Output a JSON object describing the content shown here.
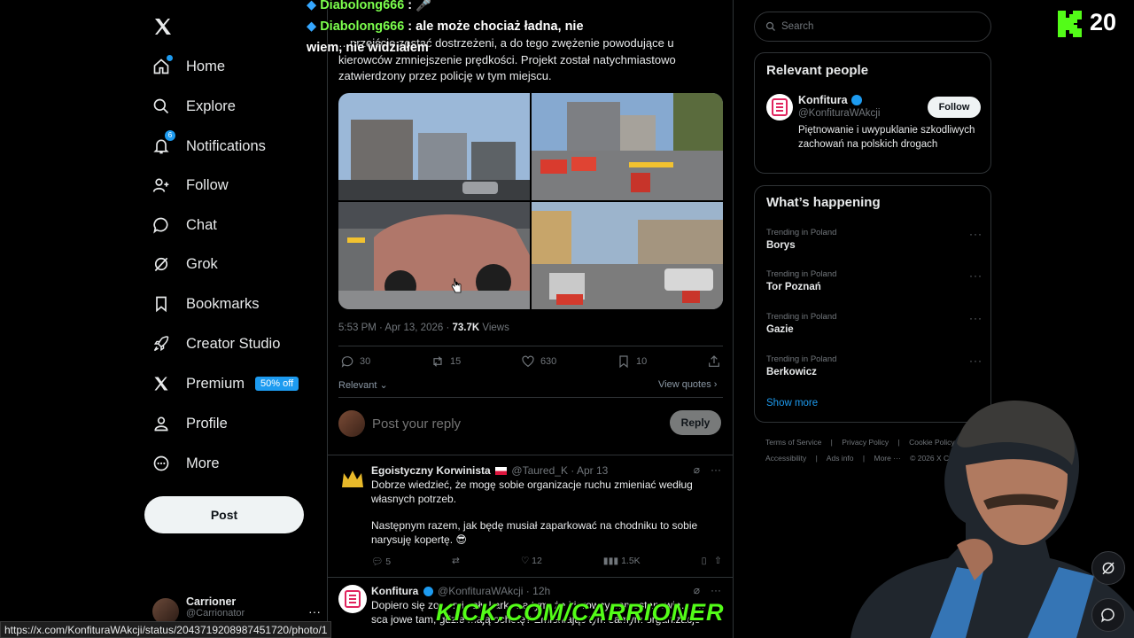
{
  "nav": {
    "items": [
      {
        "label": "Home",
        "icon": "home-icon"
      },
      {
        "label": "Explore",
        "icon": "search-icon"
      },
      {
        "label": "Notifications",
        "icon": "bell-icon",
        "badge": "6"
      },
      {
        "label": "Follow",
        "icon": "person-plus-icon"
      },
      {
        "label": "Chat",
        "icon": "chat-bubble-icon"
      },
      {
        "label": "Grok",
        "icon": "grok-icon"
      },
      {
        "label": "Bookmarks",
        "icon": "bookmark-icon"
      },
      {
        "label": "Creator Studio",
        "icon": "rocket-icon"
      },
      {
        "label": "Premium",
        "icon": "x-logo-icon",
        "tag": "50% off"
      },
      {
        "label": "Profile",
        "icon": "person-icon"
      },
      {
        "label": "More",
        "icon": "more-circle-icon"
      }
    ],
    "post_label": "Post",
    "account": {
      "name": "Carrioner",
      "handle": "@Carrionator",
      "more": "···"
    }
  },
  "tweet": {
    "text": "…przejście zostać dostrzeżeni, a do tego zwężenie powodujące u kierowców zmniejszenie prędkości. Projekt został natychmiastowo zatwierdzony przez policję w tym miejscu.",
    "time": "5:53 PM · Apr 13, 2026 · ",
    "views": "73.7K",
    "views_label": " Views",
    "replies": "30",
    "reposts": "15",
    "likes": "630",
    "bookmarks": "10",
    "sort_label": "Relevant",
    "view_quotes": "View quotes"
  },
  "reply_box": {
    "placeholder": "Post your reply",
    "button": "Reply"
  },
  "replies": [
    {
      "name": "Egoistyczny Korwinista",
      "handle": "@Taured_K",
      "time": "Apr 13",
      "body1": "Dobrze wiedzieć, że mogę sobie organizacje ruchu zmieniać według własnych potrzeb.",
      "body2": "Następnym razem, jak będę musiał zaparkować na chodniku to sobie narysuję kopertę. 😎",
      "replies": "5",
      "likes": "12",
      "views": "1.5K"
    },
    {
      "name": "Konfitura",
      "handle": "@KonfituraWAkcji",
      "time": "12h",
      "body1": "Dopiero się zo… mi cały kark… a tym, że kierowcy samostanowią… …sca jowe tam, gdzie mają ochotę? Zmieniając tym samym organizacje"
    }
  ],
  "search": {
    "placeholder": "Search"
  },
  "relevant_people": {
    "title": "Relevant people",
    "name": "Konfitura",
    "handle": "@KonfituraWAkcji",
    "bio": "Piętnowanie i uwypuklanie szkodliwych zachowań na polskich drogach",
    "follow": "Follow"
  },
  "happening": {
    "title": "What’s happening",
    "trends": [
      {
        "context": "Trending in Poland",
        "title": "Borys"
      },
      {
        "context": "Trending in Poland",
        "title": "Tor Poznań"
      },
      {
        "context": "Trending in Poland",
        "title": "Gazie"
      },
      {
        "context": "Trending in Poland",
        "title": "Berkowicz"
      }
    ],
    "show_more": "Show more"
  },
  "footer": {
    "row1": [
      "Terms of Service",
      "|",
      "Privacy Policy",
      "|",
      "Cookie Policy",
      "|"
    ],
    "row2": [
      "Accessibility",
      "|",
      "Ads info",
      "|",
      "More ···",
      "© 2026 X Corp."
    ]
  },
  "overlay": {
    "chat1_user": "Diabolong666",
    "chat1_msg": " : 🎤",
    "chat2_user": "Diabolong666",
    "chat2_msg": " : ale może chociaż ładna, nie",
    "chat2_msg_line2": "wiem, nie widziałem",
    "kick_count": "20",
    "kick_banner": "KICK.COM/CARRIONER",
    "status_url": "https://x.com/KonfituraWAkcji/status/2043719208987451720/photo/1"
  },
  "colors": {
    "accent": "#1d9bf0",
    "kick_green": "#53fc18",
    "chat_user": "#7cff4d"
  }
}
